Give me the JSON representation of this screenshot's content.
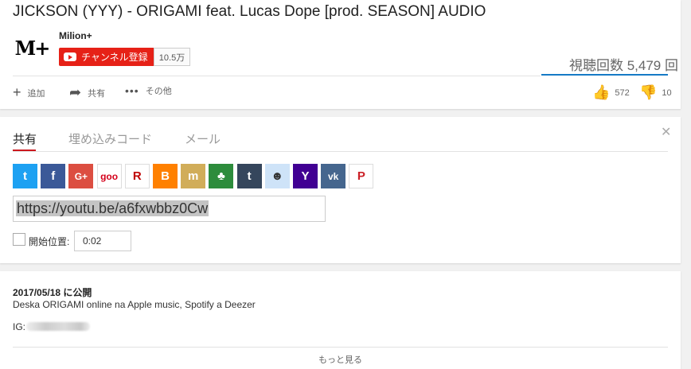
{
  "video": {
    "title": "JICKSON (YYY) - ORIGAMI feat. Lucas Dope [prod. SEASON] AUDIO",
    "views": "視聴回数 5,479 回"
  },
  "channel": {
    "avatar_text": "M+",
    "name": "Milion+",
    "subscribe_label": "チャンネル登録",
    "subscriber_count": "10.5万"
  },
  "actions": {
    "add": "追加",
    "share": "共有",
    "more": "その他",
    "likes": "572",
    "dislikes": "10"
  },
  "share_panel": {
    "tabs": [
      "共有",
      "埋め込みコード",
      "メール"
    ],
    "url": "https://youtu.be/a6fxwbbz0Cw",
    "start_label": "開始位置:",
    "start_time": "0:02",
    "services": [
      {
        "name": "twitter",
        "glyph": "t",
        "color": "#1da1f2"
      },
      {
        "name": "facebook",
        "glyph": "f",
        "color": "#3b5998"
      },
      {
        "name": "google-plus",
        "glyph": "G+",
        "color": "#dc4e41"
      },
      {
        "name": "goo",
        "glyph": "goo",
        "color": "#ffffff"
      },
      {
        "name": "rakuten",
        "glyph": "R",
        "color": "#ffffff"
      },
      {
        "name": "blogger",
        "glyph": "B",
        "color": "#ff8000"
      },
      {
        "name": "mixi",
        "glyph": "m",
        "color": "#d1ad59"
      },
      {
        "name": "ameba",
        "glyph": "♣",
        "color": "#2d8c3c"
      },
      {
        "name": "tumblr",
        "glyph": "t",
        "color": "#35465c"
      },
      {
        "name": "reddit",
        "glyph": "☻",
        "color": "#cee3f8"
      },
      {
        "name": "yahoo",
        "glyph": "Y",
        "color": "#410093"
      },
      {
        "name": "vk",
        "glyph": "vk",
        "color": "#45668e"
      },
      {
        "name": "pinterest",
        "glyph": "P",
        "color": "#ffffff"
      }
    ]
  },
  "description": {
    "published": "2017/05/18 に公開",
    "text": "Deska ORIGAMI online na Apple music, Spotify a Deezer",
    "ig_label": "IG:",
    "show_more": "もっと見る"
  }
}
